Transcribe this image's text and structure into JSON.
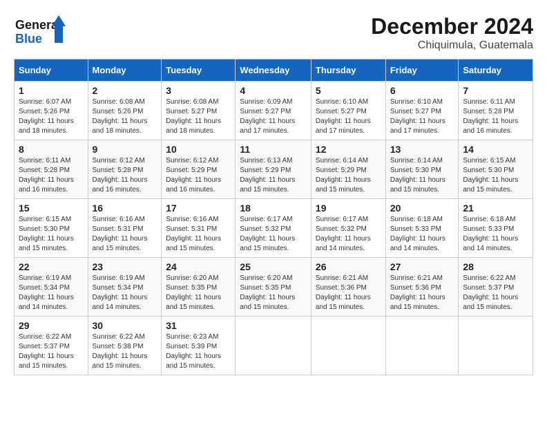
{
  "logo": {
    "line1": "General",
    "line2": "Blue"
  },
  "title": "December 2024",
  "subtitle": "Chiquimula, Guatemala",
  "days_of_week": [
    "Sunday",
    "Monday",
    "Tuesday",
    "Wednesday",
    "Thursday",
    "Friday",
    "Saturday"
  ],
  "weeks": [
    [
      {
        "day": "1",
        "info": "Sunrise: 6:07 AM\nSunset: 5:26 PM\nDaylight: 11 hours\nand 18 minutes."
      },
      {
        "day": "2",
        "info": "Sunrise: 6:08 AM\nSunset: 5:26 PM\nDaylight: 11 hours\nand 18 minutes."
      },
      {
        "day": "3",
        "info": "Sunrise: 6:08 AM\nSunset: 5:27 PM\nDaylight: 11 hours\nand 18 minutes."
      },
      {
        "day": "4",
        "info": "Sunrise: 6:09 AM\nSunset: 5:27 PM\nDaylight: 11 hours\nand 17 minutes."
      },
      {
        "day": "5",
        "info": "Sunrise: 6:10 AM\nSunset: 5:27 PM\nDaylight: 11 hours\nand 17 minutes."
      },
      {
        "day": "6",
        "info": "Sunrise: 6:10 AM\nSunset: 5:27 PM\nDaylight: 11 hours\nand 17 minutes."
      },
      {
        "day": "7",
        "info": "Sunrise: 6:11 AM\nSunset: 5:28 PM\nDaylight: 11 hours\nand 16 minutes."
      }
    ],
    [
      {
        "day": "8",
        "info": "Sunrise: 6:11 AM\nSunset: 5:28 PM\nDaylight: 11 hours\nand 16 minutes."
      },
      {
        "day": "9",
        "info": "Sunrise: 6:12 AM\nSunset: 5:28 PM\nDaylight: 11 hours\nand 16 minutes."
      },
      {
        "day": "10",
        "info": "Sunrise: 6:12 AM\nSunset: 5:29 PM\nDaylight: 11 hours\nand 16 minutes."
      },
      {
        "day": "11",
        "info": "Sunrise: 6:13 AM\nSunset: 5:29 PM\nDaylight: 11 hours\nand 15 minutes."
      },
      {
        "day": "12",
        "info": "Sunrise: 6:14 AM\nSunset: 5:29 PM\nDaylight: 11 hours\nand 15 minutes."
      },
      {
        "day": "13",
        "info": "Sunrise: 6:14 AM\nSunset: 5:30 PM\nDaylight: 11 hours\nand 15 minutes."
      },
      {
        "day": "14",
        "info": "Sunrise: 6:15 AM\nSunset: 5:30 PM\nDaylight: 11 hours\nand 15 minutes."
      }
    ],
    [
      {
        "day": "15",
        "info": "Sunrise: 6:15 AM\nSunset: 5:30 PM\nDaylight: 11 hours\nand 15 minutes."
      },
      {
        "day": "16",
        "info": "Sunrise: 6:16 AM\nSunset: 5:31 PM\nDaylight: 11 hours\nand 15 minutes."
      },
      {
        "day": "17",
        "info": "Sunrise: 6:16 AM\nSunset: 5:31 PM\nDaylight: 11 hours\nand 15 minutes."
      },
      {
        "day": "18",
        "info": "Sunrise: 6:17 AM\nSunset: 5:32 PM\nDaylight: 11 hours\nand 15 minutes."
      },
      {
        "day": "19",
        "info": "Sunrise: 6:17 AM\nSunset: 5:32 PM\nDaylight: 11 hours\nand 14 minutes."
      },
      {
        "day": "20",
        "info": "Sunrise: 6:18 AM\nSunset: 5:33 PM\nDaylight: 11 hours\nand 14 minutes."
      },
      {
        "day": "21",
        "info": "Sunrise: 6:18 AM\nSunset: 5:33 PM\nDaylight: 11 hours\nand 14 minutes."
      }
    ],
    [
      {
        "day": "22",
        "info": "Sunrise: 6:19 AM\nSunset: 5:34 PM\nDaylight: 11 hours\nand 14 minutes."
      },
      {
        "day": "23",
        "info": "Sunrise: 6:19 AM\nSunset: 5:34 PM\nDaylight: 11 hours\nand 14 minutes."
      },
      {
        "day": "24",
        "info": "Sunrise: 6:20 AM\nSunset: 5:35 PM\nDaylight: 11 hours\nand 15 minutes."
      },
      {
        "day": "25",
        "info": "Sunrise: 6:20 AM\nSunset: 5:35 PM\nDaylight: 11 hours\nand 15 minutes."
      },
      {
        "day": "26",
        "info": "Sunrise: 6:21 AM\nSunset: 5:36 PM\nDaylight: 11 hours\nand 15 minutes."
      },
      {
        "day": "27",
        "info": "Sunrise: 6:21 AM\nSunset: 5:36 PM\nDaylight: 11 hours\nand 15 minutes."
      },
      {
        "day": "28",
        "info": "Sunrise: 6:22 AM\nSunset: 5:37 PM\nDaylight: 11 hours\nand 15 minutes."
      }
    ],
    [
      {
        "day": "29",
        "info": "Sunrise: 6:22 AM\nSunset: 5:37 PM\nDaylight: 11 hours\nand 15 minutes."
      },
      {
        "day": "30",
        "info": "Sunrise: 6:22 AM\nSunset: 5:38 PM\nDaylight: 11 hours\nand 15 minutes."
      },
      {
        "day": "31",
        "info": "Sunrise: 6:23 AM\nSunset: 5:39 PM\nDaylight: 11 hours\nand 15 minutes."
      },
      {
        "day": "",
        "info": ""
      },
      {
        "day": "",
        "info": ""
      },
      {
        "day": "",
        "info": ""
      },
      {
        "day": "",
        "info": ""
      }
    ]
  ]
}
